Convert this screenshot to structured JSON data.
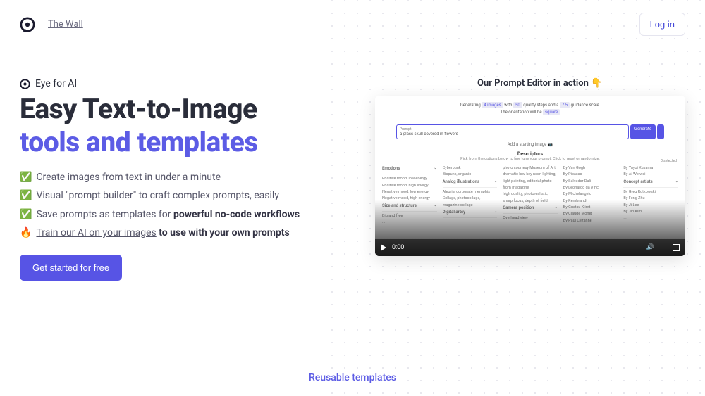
{
  "header": {
    "nav_link": "The Wall",
    "login_label": "Log in"
  },
  "brand": "Eye for AI",
  "headline_1": "Easy Text-to-Image",
  "headline_2": "tools and templates",
  "features": [
    {
      "icon": "✅",
      "html": "Create images from text in under a minute"
    },
    {
      "icon": "✅",
      "html": "Visual \"prompt builder\" to craft complex prompts, easily"
    },
    {
      "icon": "✅",
      "html": "Save prompts as templates for <strong>powerful no-code workflows</strong>"
    },
    {
      "icon": "🔥",
      "html": "<a href=\"#\">Train our AI on your images</a> <strong>to use with your own prompts</strong>"
    }
  ],
  "cta_label": "Get started for free",
  "preview": {
    "caption": "Our Prompt Editor in action 👇",
    "gen_line_prefix": "Generating",
    "gen_images_pill": "4 images",
    "gen_with": "with",
    "gen_quality_pill": "50",
    "gen_quality_suffix": "quality steps and a",
    "gen_scale_pill": "7.5",
    "gen_scale_suffix": "guidance scale.",
    "orientation_prefix": "The orientation will be",
    "orientation_pill": "square",
    "prompt_label": "Prompt",
    "prompt_value": "a glass skull covered in flowers",
    "generate_label": "Generate",
    "add_image_label": "Add a starting image 📷",
    "descriptors_heading": "Descriptors",
    "descriptors_sub": "Pick from the options below to fine tune your prompt. Click to reset or randomize.",
    "selected_count": "0 selected",
    "columns": [
      {
        "heading": "Emotions",
        "items": [
          "Positive mood, low energy",
          "Positive mood, high energy",
          "Negative mood, low energy",
          "Negative mood, high energy"
        ],
        "heading2": "Size and structure",
        "items2": [
          "Big and free",
          "..."
        ]
      },
      {
        "heading": "",
        "items_pre": [
          "Cyberpunk",
          "Biopunk, organic"
        ],
        "heading2": "Analog illustrations",
        "heading3": "Digital artsy",
        "items2": [
          "Alegria, corporate memphis",
          "Collage, photocollage, magazine collage"
        ]
      },
      {
        "items_pre": [
          "photo courtesy Museum of Art",
          "dramatic low-key neon lighting, light painting, editorial photo from magazine",
          "high quality, photorealistic, sharp focus, depth of field"
        ],
        "heading2": "Camera position",
        "items2": [
          "Overhead view"
        ]
      },
      {
        "items_pre": [
          "By Van Gogh",
          "By Picasso",
          "By Salvador Dali",
          "By Leonardo da Vinci",
          "By Michelangelo",
          "By Rembrandt",
          "By Gustav Klimt",
          "By Claude Monet",
          "By Paul Cezanne"
        ]
      },
      {
        "items_pre": [
          "By Yayoi Kusama",
          "By Ai Weiwei"
        ],
        "heading2": "Concept artists",
        "items2": [
          "By Greg Rutkowski",
          "By Feng Zhu",
          "By Ji Lee",
          "By Jin Kim",
          "..."
        ]
      }
    ],
    "video_time": "0:00"
  },
  "footer_text": "Reusable templates"
}
